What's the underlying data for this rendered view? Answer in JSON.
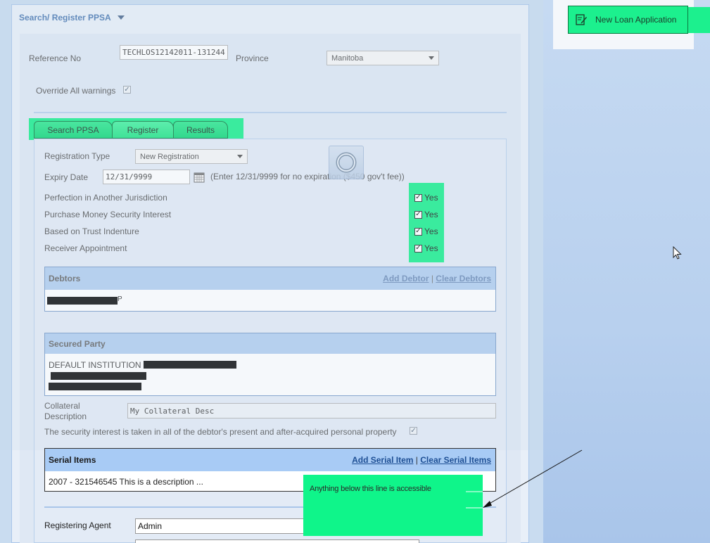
{
  "right": {
    "new_loan_label": "New Loan Application",
    "icon": "edit-document-icon"
  },
  "panel": {
    "title": "Search/ Register PPSA",
    "reference_label": "Reference No",
    "reference_value": "TECHLOS12142011-131244",
    "province_label": "Province",
    "province_value": "Manitoba",
    "override_label": "Override All warnings"
  },
  "tabs": [
    {
      "label": "Search PPSA"
    },
    {
      "label": "Register"
    },
    {
      "label": "Results"
    }
  ],
  "register": {
    "registration_type_label": "Registration Type",
    "registration_type_value": "New Registration",
    "expiry_label": "Expiry Date",
    "expiry_value": "12/31/9999",
    "expiry_hint": "(Enter 12/31/9999 for no expiration ($450 gov't fee))",
    "flags": [
      {
        "label": "Perfection in Another Jurisdiction",
        "value": "Yes",
        "checked": true
      },
      {
        "label": "Purchase Money Security Interest",
        "value": "Yes",
        "checked": true
      },
      {
        "label": "Based on Trust Indenture",
        "value": "Yes",
        "checked": true
      },
      {
        "label": "Receiver Appointment",
        "value": "Yes",
        "checked": true
      }
    ],
    "debtors": {
      "title": "Debtors",
      "add_link": "Add Debtor",
      "separator": "|",
      "clear_link": "Clear Debtors",
      "row_suffix": "P"
    },
    "secured_party": {
      "title": "Secured Party",
      "line1": "DEFAULT INSTITUTION"
    },
    "collateral_label_1": "Collateral",
    "collateral_label_2": "Description",
    "collateral_value": "My Collateral Desc",
    "security_interest_label": "The security interest is taken in all of the debtor's present and after-acquired personal property",
    "serial_items": {
      "title": "Serial Items",
      "add_link": "Add Serial Item",
      "separator": "|",
      "clear_link": "Clear Serial Items",
      "rows": [
        "2007 - 321546545 This is a description ..."
      ]
    },
    "registering_agent_label": "Registering Agent",
    "registering_agent_value": "Admin"
  },
  "annotation": {
    "text": "Anything below this line is accessible"
  },
  "colors": {
    "highlight": "#1cf08e",
    "grid_header": "#b3cff0",
    "link": "#6e8db8"
  }
}
